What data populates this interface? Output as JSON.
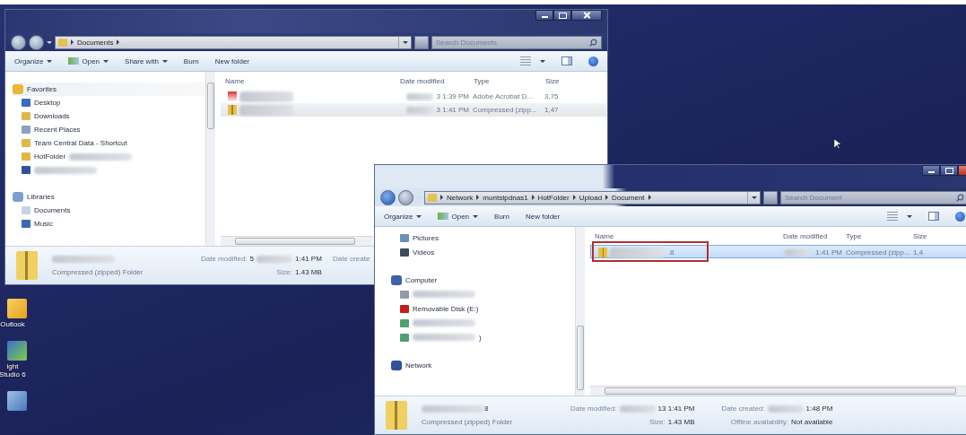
{
  "desktop_icons": [
    {
      "label": "Outlook",
      "kind": "outlook"
    },
    {
      "label": "ight Studio 6",
      "kind": "studio"
    },
    {
      "kind": "app"
    }
  ],
  "windows": [
    {
      "address": [
        "Documents"
      ],
      "search_placeholder": "Search Documents",
      "kind": "full",
      "toolbar": [
        {
          "label": "Organize",
          "dropdown": true,
          "kind": "plain"
        },
        {
          "label": "Open",
          "dropdown": true,
          "kind": "open"
        },
        {
          "label": "Share with",
          "dropdown": true,
          "kind": "plain"
        },
        {
          "label": "Burn",
          "dropdown": false,
          "kind": "plain"
        },
        {
          "label": "New folder",
          "dropdown": false,
          "kind": "plain"
        }
      ],
      "sidebar": [
        {
          "label": "Favorites",
          "kind": "star",
          "group": true
        },
        {
          "label": "Desktop",
          "kind": "desktop"
        },
        {
          "label": "Downloads",
          "kind": "folder"
        },
        {
          "label": "Recent Places",
          "kind": "recent"
        },
        {
          "label": "Team Central Data - Shortcut",
          "kind": "folder"
        },
        {
          "label": "HotFolder",
          "kind": "folder",
          "redacted": true
        },
        {
          "kind": "network",
          "redacted": true
        },
        {
          "kind": "gap"
        },
        {
          "label": "Libraries",
          "kind": "library",
          "group": true
        },
        {
          "label": "Documents",
          "kind": "document"
        },
        {
          "label": "Music",
          "kind": "music"
        }
      ],
      "columns": [
        "Name",
        "Date modified",
        "Type",
        "Size"
      ],
      "files": [
        {
          "kind": "pdf",
          "date": "3 1:39 PM",
          "type": "Adobe Acrobat D...",
          "size": "3,75",
          "selected": false,
          "hover": false
        },
        {
          "kind": "zip",
          "date": "3 1:41 PM",
          "type": "Compressed (zipp...",
          "size": "1,47",
          "selected": false,
          "hover": true
        }
      ],
      "details": {
        "type": "Compressed (zipped) Folder",
        "fields": [
          {
            "label": "Date modified:",
            "prefix": "5",
            "value": "1:41 PM",
            "redacted": true
          },
          {
            "label": "Size:",
            "value": "1.43 MB"
          }
        ],
        "cut_label": "Date create"
      }
    },
    {
      "address": [
        "Network",
        "muntstpdnas1",
        "HotFolder",
        "Upload",
        "Document"
      ],
      "search_placeholder": "Search Document",
      "kind": "cut",
      "toolbar": [
        {
          "label": "Organize",
          "dropdown": true,
          "kind": "plain"
        },
        {
          "label": "Open",
          "dropdown": true,
          "kind": "open"
        },
        {
          "label": "Burn",
          "dropdown": false,
          "kind": "plain"
        },
        {
          "label": "New folder",
          "dropdown": false,
          "kind": "plain"
        }
      ],
      "sidebar": [
        {
          "label": "Pictures",
          "kind": "pictures"
        },
        {
          "label": "Videos",
          "kind": "video"
        },
        {
          "kind": "gap"
        },
        {
          "label": "Computer",
          "kind": "computer",
          "group": true
        },
        {
          "kind": "drive",
          "redacted": true
        },
        {
          "label": "Removable Disk (E:)",
          "kind": "removable"
        },
        {
          "kind": "netdrive",
          "redacted": true
        },
        {
          "kind": "netdrive",
          "redacted": true,
          "suffix": ")"
        },
        {
          "kind": "gap"
        },
        {
          "label": "Network",
          "kind": "network",
          "group": true
        }
      ],
      "columns": [
        "Name",
        "Date modified",
        "Type",
        "Size"
      ],
      "files": [
        {
          "kind": "zip",
          "suffix": "8",
          "date": "1:41 PM",
          "type": "Compressed (zipp...",
          "size": "1,4",
          "selected": true,
          "annotated": true
        }
      ],
      "details": {
        "name_suffix": "8",
        "type": "Compressed (zipped) Folder",
        "fields": [
          {
            "label": "Date modified:",
            "value": "13 1:41 PM",
            "redacted": true
          },
          {
            "label": "Size:",
            "value": "1.43 MB"
          },
          {
            "label": "Date created:",
            "value": "1:48 PM",
            "redacted": true
          },
          {
            "label": "Offline availability:",
            "value": "Not available"
          }
        ]
      }
    }
  ]
}
